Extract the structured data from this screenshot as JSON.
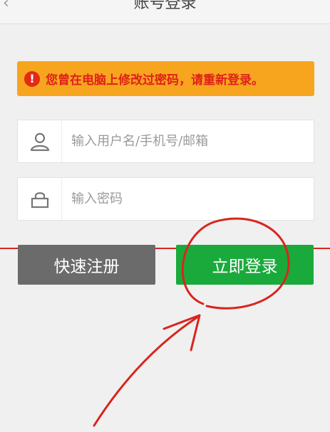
{
  "header": {
    "title": "账号登录"
  },
  "warning": {
    "text": "您曾在电脑上修改过密码，请重新登录。"
  },
  "form": {
    "username_placeholder": "输入用户名/手机号/邮箱",
    "password_placeholder": "输入密码"
  },
  "buttons": {
    "register_label": "快速注册",
    "login_label": "立即登录"
  },
  "colors": {
    "warning_bg": "#f7a51f",
    "warning_text": "#e0201a",
    "login_green": "#1aaa3c",
    "register_gray": "#6b6b6b",
    "annotation_red": "#d8261c"
  },
  "icons": {
    "back": "chevron-left-icon",
    "warning": "exclamation-circle-icon",
    "user": "user-icon",
    "lock": "lock-icon"
  }
}
